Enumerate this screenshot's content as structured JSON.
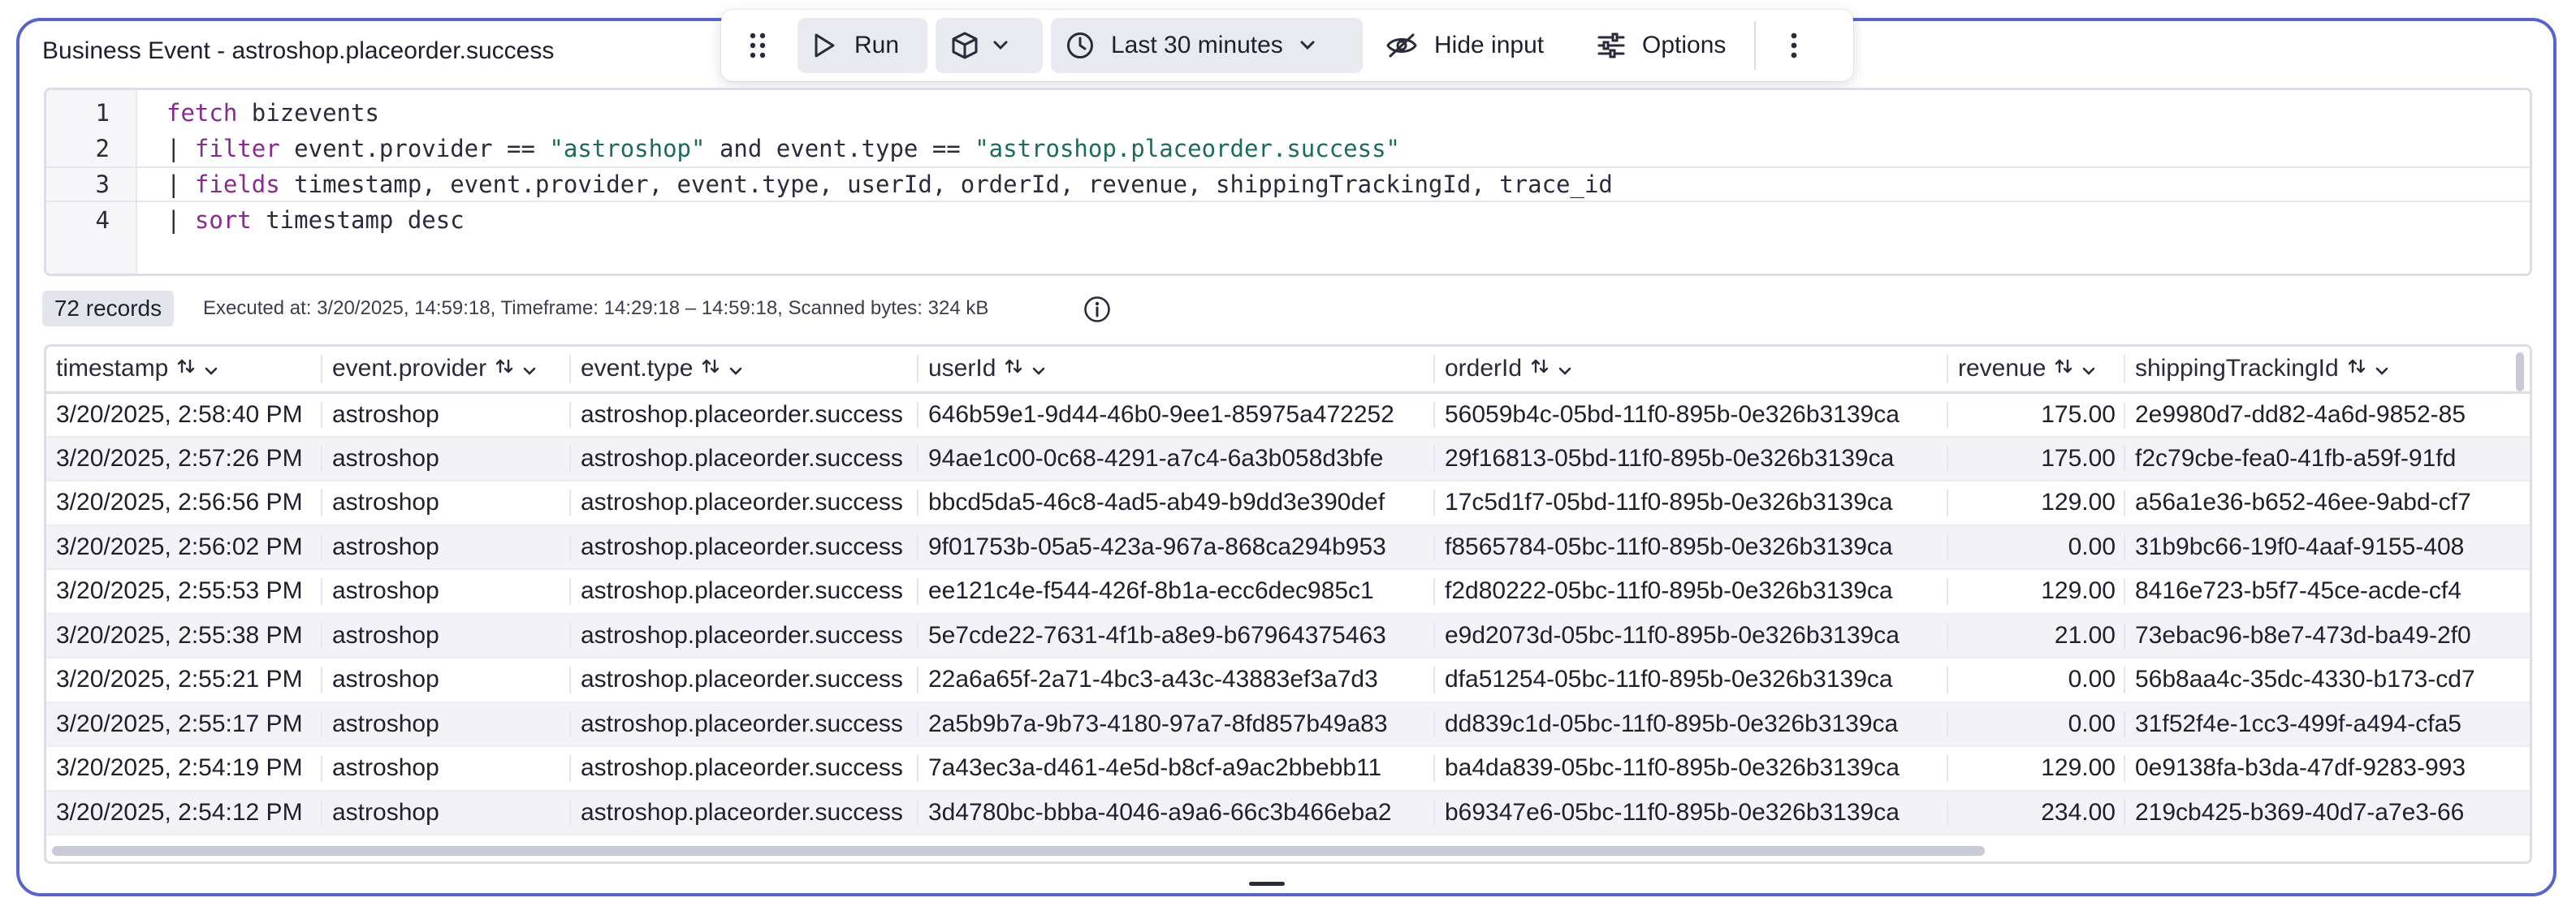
{
  "title": "Business Event - astroshop.placeorder.success",
  "toolbar": {
    "run_label": "Run",
    "timeframe_label": "Last 30 minutes",
    "hide_input_label": "Hide input",
    "options_label": "Options",
    "icons": [
      "drag-handle-icon",
      "play-icon",
      "cube-icon",
      "chevron-down-icon",
      "clock-icon",
      "eye-off-icon",
      "sliders-icon",
      "more-vertical-icon"
    ]
  },
  "editor": {
    "line_numbers": [
      "1",
      "2",
      "3",
      "4"
    ],
    "lines": [
      [
        {
          "t": "fetch",
          "c": "kw"
        },
        {
          "t": " bizevents",
          "c": ""
        }
      ],
      [
        {
          "t": "| ",
          "c": ""
        },
        {
          "t": "filter",
          "c": "kw"
        },
        {
          "t": " event.provider == ",
          "c": ""
        },
        {
          "t": "\"astroshop\"",
          "c": "str"
        },
        {
          "t": " and event.type == ",
          "c": ""
        },
        {
          "t": "\"astroshop.placeorder.success\"",
          "c": "str"
        }
      ],
      [
        {
          "t": "| ",
          "c": ""
        },
        {
          "t": "fields",
          "c": "kw"
        },
        {
          "t": " timestamp, event.provider, event.type, userId, orderId, revenue, shippingTrackingId, trace_id",
          "c": ""
        }
      ],
      [
        {
          "t": "| ",
          "c": ""
        },
        {
          "t": "sort",
          "c": "kw"
        },
        {
          "t": " timestamp desc",
          "c": ""
        }
      ]
    ]
  },
  "results": {
    "records_label": "72 records",
    "exec_info": "Executed at: 3/20/2025, 14:59:18, Timeframe: 14:29:18 – 14:59:18, Scanned bytes: 324 kB"
  },
  "table": {
    "columns": [
      "timestamp",
      "event.provider",
      "event.type",
      "userId",
      "orderId",
      "revenue",
      "shippingTrackingId"
    ],
    "rows": [
      [
        "3/20/2025, 2:58:40 PM",
        "astroshop",
        "astroshop.placeorder.success",
        "646b59e1-9d44-46b0-9ee1-85975a472252",
        "56059b4c-05bd-11f0-895b-0e326b3139ca",
        "175.00",
        "2e9980d7-dd82-4a6d-9852-85"
      ],
      [
        "3/20/2025, 2:57:26 PM",
        "astroshop",
        "astroshop.placeorder.success",
        "94ae1c00-0c68-4291-a7c4-6a3b058d3bfe",
        "29f16813-05bd-11f0-895b-0e326b3139ca",
        "175.00",
        "f2c79cbe-fea0-41fb-a59f-91fd"
      ],
      [
        "3/20/2025, 2:56:56 PM",
        "astroshop",
        "astroshop.placeorder.success",
        "bbcd5da5-46c8-4ad5-ab49-b9dd3e390def",
        "17c5d1f7-05bd-11f0-895b-0e326b3139ca",
        "129.00",
        "a56a1e36-b652-46ee-9abd-cf7"
      ],
      [
        "3/20/2025, 2:56:02 PM",
        "astroshop",
        "astroshop.placeorder.success",
        "9f01753b-05a5-423a-967a-868ca294b953",
        "f8565784-05bc-11f0-895b-0e326b3139ca",
        "0.00",
        "31b9bc66-19f0-4aaf-9155-408"
      ],
      [
        "3/20/2025, 2:55:53 PM",
        "astroshop",
        "astroshop.placeorder.success",
        "ee121c4e-f544-426f-8b1a-ecc6dec985c1",
        "f2d80222-05bc-11f0-895b-0e326b3139ca",
        "129.00",
        "8416e723-b5f7-45ce-acde-cf4"
      ],
      [
        "3/20/2025, 2:55:38 PM",
        "astroshop",
        "astroshop.placeorder.success",
        "5e7cde22-7631-4f1b-a8e9-b67964375463",
        "e9d2073d-05bc-11f0-895b-0e326b3139ca",
        "21.00",
        "73ebac96-b8e7-473d-ba49-2f0"
      ],
      [
        "3/20/2025, 2:55:21 PM",
        "astroshop",
        "astroshop.placeorder.success",
        "22a6a65f-2a71-4bc3-a43c-43883ef3a7d3",
        "dfa51254-05bc-11f0-895b-0e326b3139ca",
        "0.00",
        "56b8aa4c-35dc-4330-b173-cd7"
      ],
      [
        "3/20/2025, 2:55:17 PM",
        "astroshop",
        "astroshop.placeorder.success",
        "2a5b9b7a-9b73-4180-97a7-8fd857b49a83",
        "dd839c1d-05bc-11f0-895b-0e326b3139ca",
        "0.00",
        "31f52f4e-1cc3-499f-a494-cfa5"
      ],
      [
        "3/20/2025, 2:54:19 PM",
        "astroshop",
        "astroshop.placeorder.success",
        "7a43ec3a-d461-4e5d-b8cf-a9ac2bbebb11",
        "ba4da839-05bc-11f0-895b-0e326b3139ca",
        "129.00",
        "0e9138fa-b3da-47df-9283-993"
      ],
      [
        "3/20/2025, 2:54:12 PM",
        "astroshop",
        "astroshop.placeorder.success",
        "3d4780bc-bbba-4046-a9a6-66c3b466eba2",
        "b69347e6-05bc-11f0-895b-0e326b3139ca",
        "234.00",
        "219cb425-b369-40d7-a7e3-66"
      ]
    ]
  }
}
